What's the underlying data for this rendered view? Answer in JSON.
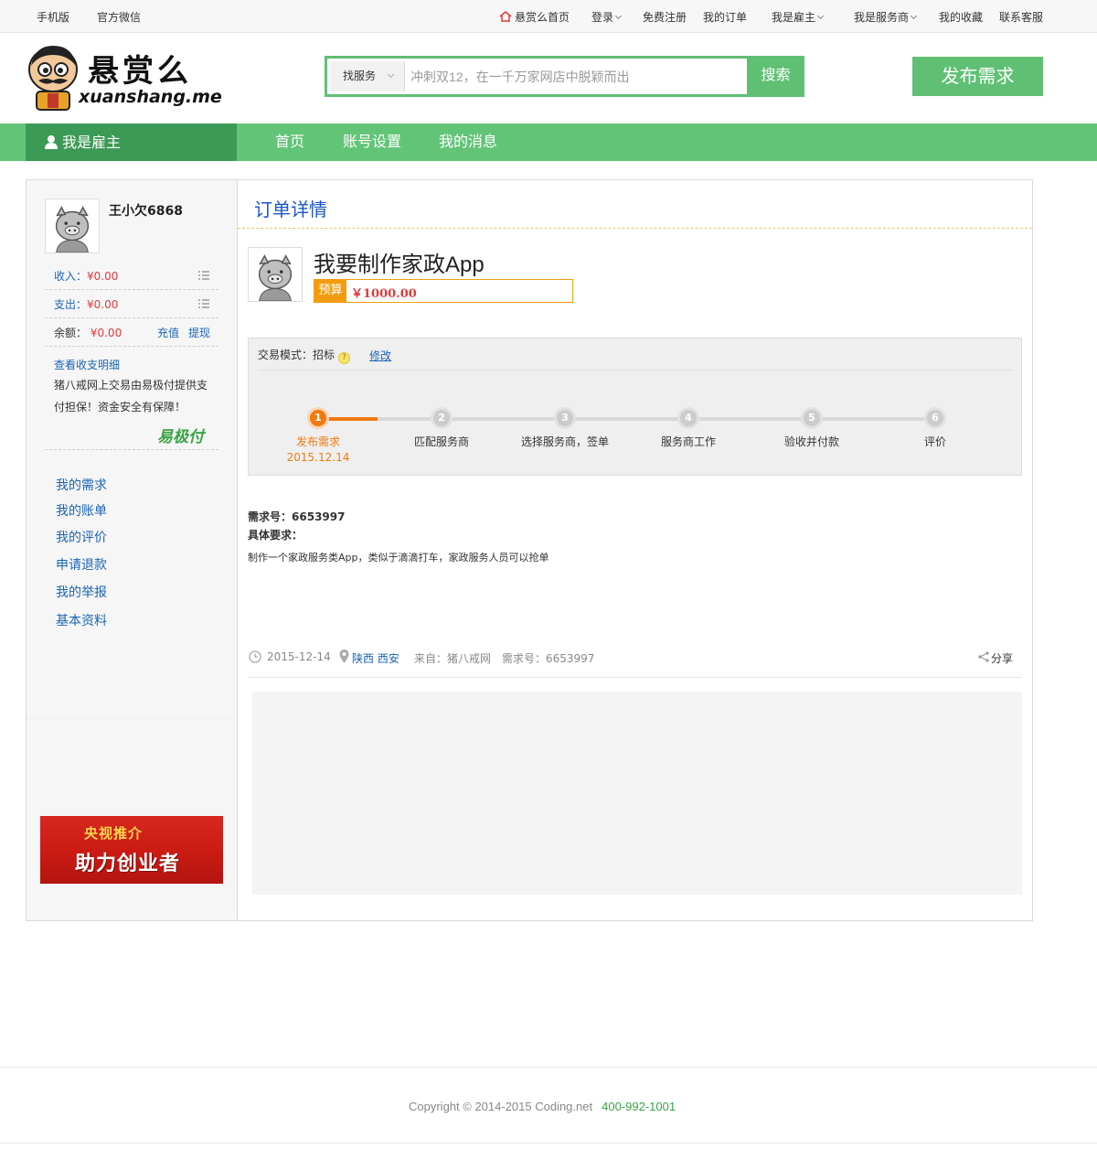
{
  "topbar": {
    "mobile": "手机版",
    "wechat": "官方微信",
    "home": "悬赏么首页",
    "login": "登录",
    "register": "免费注册",
    "orders": "我的订单",
    "employer": "我是雇主",
    "provider": "我是服务商",
    "favorites": "我的收藏",
    "support": "联系客服"
  },
  "logo": {
    "title": "悬赏么",
    "domain": "xuanshang.me"
  },
  "search": {
    "category": "找服务",
    "placeholder": "冲刺双12，在一千万家网店中脱颖而出",
    "button": "搜索"
  },
  "publish_button": "发布需求",
  "nav": {
    "role": "我是雇主",
    "items": [
      "首页",
      "账号设置",
      "我的消息"
    ]
  },
  "sidebar": {
    "username": "王小欠6868",
    "income_label": "收入：",
    "income_value": "¥0.00",
    "expense_label": "支出：",
    "expense_value": "¥0.00",
    "balance_label": "余额：",
    "balance_value": "¥0.00",
    "recharge": "充值",
    "withdraw": "提现",
    "details_link": "查看收支明细",
    "note": "猪八戒网上交易由易极付提供支付担保！资金安全有保障！",
    "payment_brand": "易极付",
    "menu": [
      "我的需求",
      "我的账单",
      "我的评价",
      "申请退款",
      "我的举报",
      "基本资料"
    ],
    "banner": {
      "line1": "央视推介",
      "line2": "助力创业者"
    }
  },
  "order": {
    "section_title": "订单详情",
    "title": "我要制作家政App",
    "budget_label": "预算",
    "budget_value": "￥1000.00",
    "mode_label": "交易模式：",
    "mode_value": "招标",
    "modify": "修改",
    "steps": [
      {
        "num": "1",
        "label": "发布需求",
        "date": "2015.12.14",
        "active": true
      },
      {
        "num": "2",
        "label": "匹配服务商"
      },
      {
        "num": "3",
        "label": "选择服务商，签单"
      },
      {
        "num": "4",
        "label": "服务商工作"
      },
      {
        "num": "5",
        "label": "验收并付款"
      },
      {
        "num": "6",
        "label": "评价"
      }
    ],
    "req_no_label": "需求号：",
    "req_no": "6653997",
    "detail_label": "具体要求：",
    "detail": "制作一个家政服务类App，类似于滴滴打车，家政服务人员可以抢单",
    "meta_date": "2015-12-14",
    "meta_location": "陕西 西安",
    "meta_source": "来自：猪八戒网",
    "meta_req": "需求号：6653997",
    "share": "分享"
  },
  "footer": {
    "copyright": "Copyright © 2014-2015   Coding.net",
    "phone": "400-992-1001"
  },
  "colors": {
    "brand_green": "#62c477",
    "dark_green": "#3b9a55",
    "accent_orange": "#f07a10",
    "link_blue": "#1a65b5"
  }
}
